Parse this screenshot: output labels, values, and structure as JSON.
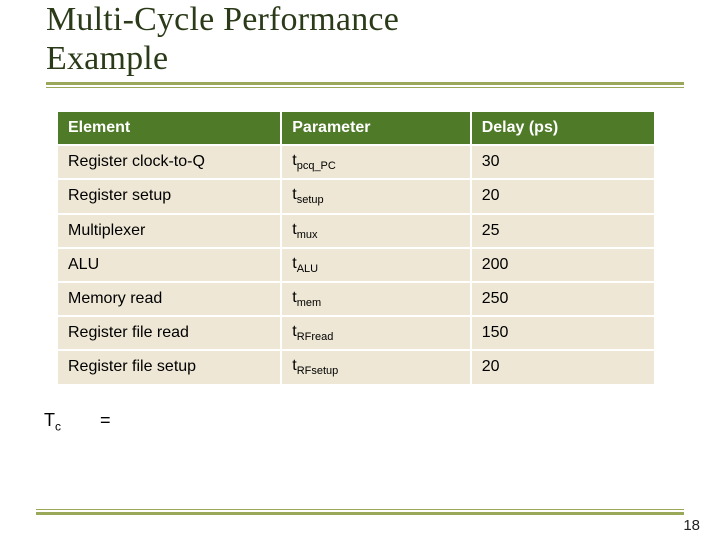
{
  "title_line1": "Multi-Cycle Performance",
  "title_line2": "Example",
  "table": {
    "headers": {
      "element": "Element",
      "parameter": "Parameter",
      "delay": "Delay (ps)"
    },
    "rows": [
      {
        "element": "Register clock-to-Q",
        "param_base": "t",
        "param_sub": "pcq_PC",
        "delay": "30"
      },
      {
        "element": "Register setup",
        "param_base": "t",
        "param_sub": "setup",
        "delay": "20"
      },
      {
        "element": "Multiplexer",
        "param_base": "t",
        "param_sub": "mux",
        "delay": "25"
      },
      {
        "element": "ALU",
        "param_base": "t",
        "param_sub": "ALU",
        "delay": "200"
      },
      {
        "element": "Memory read",
        "param_base": "t",
        "param_sub": "mem",
        "delay": "250"
      },
      {
        "element": "Register file read",
        "param_base": "t",
        "param_sub": "RFread",
        "delay": "150"
      },
      {
        "element": "Register file setup",
        "param_base": "t",
        "param_sub": "RFsetup",
        "delay": "20"
      }
    ]
  },
  "equation": {
    "lhs_base": "T",
    "lhs_sub": "c",
    "rhs": "="
  },
  "page_number": "18"
}
